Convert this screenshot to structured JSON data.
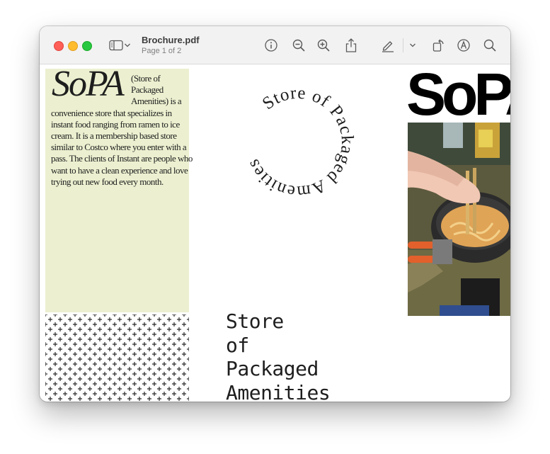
{
  "window": {
    "doc_title": "Brochure.pdf",
    "page_info": "Page 1 of 2"
  },
  "toolbar": {
    "icons": [
      "sidebar-icon",
      "chevron-down-icon",
      "info-icon",
      "zoom-out-icon",
      "zoom-in-icon",
      "share-icon",
      "highlight-pen-icon",
      "chevron-down-icon",
      "rotate-icon",
      "markup-icon",
      "search-icon"
    ]
  },
  "page": {
    "sopa_italic": "SoPA",
    "description": "(Store of Packaged Amenities) is a convenience store that specializes in instant food ranging from ramen to ice cream. It is a membership based store similar to Costco where you enter with a pass. The clients of Instant are people who want to have a clean experience and love trying out new food every month.",
    "circle_text": "Store of Packaged Amenities",
    "stack_title": [
      "Store",
      "of",
      "Packaged",
      "Amenities"
    ],
    "sopa_bold": "SoPA"
  },
  "colors": {
    "panel_green": "#ecf0d0",
    "text_dark": "#1e1e1e",
    "close": "#fe5f57",
    "minimize": "#febc2e",
    "zoom": "#28c840"
  }
}
